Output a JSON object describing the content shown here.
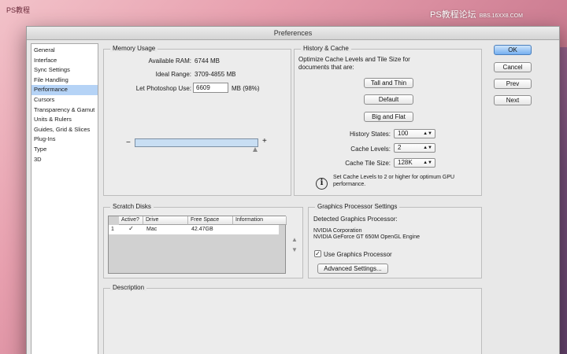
{
  "watermark": {
    "left": "PS教程",
    "right": "PS教程论坛",
    "right_small": "BBS.16XX8.COM"
  },
  "window": {
    "title": "Preferences"
  },
  "sidebar": {
    "items": [
      "General",
      "Interface",
      "Sync Settings",
      "File Handling",
      "Performance",
      "Cursors",
      "Transparency & Gamut",
      "Units & Rulers",
      "Guides, Grid & Slices",
      "Plug-Ins",
      "Type",
      "3D"
    ],
    "selected": "Performance"
  },
  "memory": {
    "title": "Memory Usage",
    "available_label": "Available RAM:",
    "available_value": "6744 MB",
    "ideal_label": "Ideal Range:",
    "ideal_value": "3709-4855 MB",
    "use_label": "Let Photoshop Use:",
    "use_value": "6609",
    "use_unit": "MB (98%)",
    "minus": "−",
    "plus": "+"
  },
  "history": {
    "title": "History & Cache",
    "description": "Optimize Cache Levels and Tile Size for documents that are:",
    "btn_tall": "Tall and Thin",
    "btn_default": "Default",
    "btn_big": "Big and Flat",
    "states_label": "History States:",
    "states_value": "100",
    "levels_label": "Cache Levels:",
    "levels_value": "2",
    "tile_label": "Cache Tile Size:",
    "tile_value": "128K",
    "info": "Set Cache Levels to 2 or higher for optimum GPU performance."
  },
  "scratch": {
    "title": "Scratch Disks",
    "headers": [
      "Active?",
      "Drive",
      "Free Space",
      "Information"
    ],
    "row": {
      "num": "1",
      "check": "✓",
      "drive": "Mac",
      "free": "42.47GB",
      "info": ""
    }
  },
  "gpu": {
    "title": "Graphics Processor Settings",
    "detected_label": "Detected Graphics Processor:",
    "vendor": "NVIDIA Corporation",
    "model": "NVIDIA GeForce GT 650M OpenGL Engine",
    "use_label": "Use Graphics Processor",
    "advanced": "Advanced Settings..."
  },
  "description": {
    "title": "Description"
  },
  "actions": {
    "ok": "OK",
    "cancel": "Cancel",
    "prev": "Prev",
    "next": "Next"
  }
}
